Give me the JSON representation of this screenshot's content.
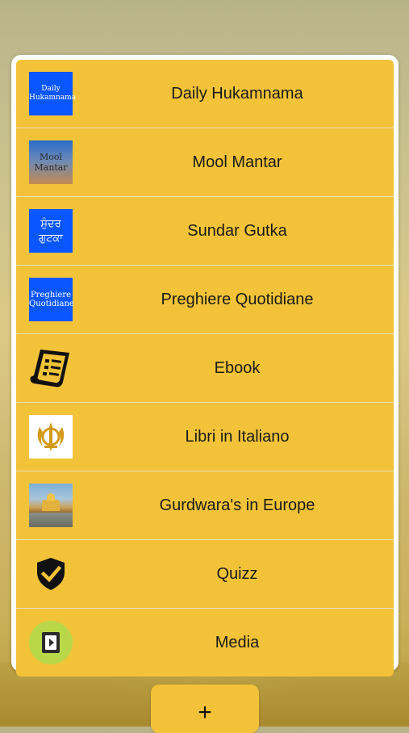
{
  "menu": {
    "items": [
      {
        "label": "Daily Hukamnama",
        "icon": "daily-hukamnama-icon",
        "icon_text": [
          "Daily",
          "Hukamnama"
        ]
      },
      {
        "label": "Mool Mantar",
        "icon": "mool-mantar-icon",
        "icon_text": [
          "Mool",
          "Mantar"
        ]
      },
      {
        "label": "Sundar Gutka",
        "icon": "sundar-gutka-icon",
        "icon_text": [
          "ਸੁੰਦਰ",
          "ਗੁਟਕਾ"
        ]
      },
      {
        "label": "Preghiere Quotidiane",
        "icon": "preghiere-quotidiane-icon",
        "icon_text": [
          "Preghiere",
          "Quotidiane"
        ]
      },
      {
        "label": "Ebook",
        "icon": "scroll-document-icon"
      },
      {
        "label": "Libri in Italiano",
        "icon": "khanda-icon"
      },
      {
        "label": "Gurdwara's in Europe",
        "icon": "golden-temple-photo-icon"
      },
      {
        "label": "Quizz",
        "icon": "shield-check-icon"
      },
      {
        "label": "Media",
        "icon": "media-player-icon"
      }
    ]
  },
  "fab": {
    "label": "+"
  },
  "colors": {
    "row_bg": "#f2c338",
    "panel_bg": "#ffffff",
    "icon_blue": "#0a56ff"
  }
}
